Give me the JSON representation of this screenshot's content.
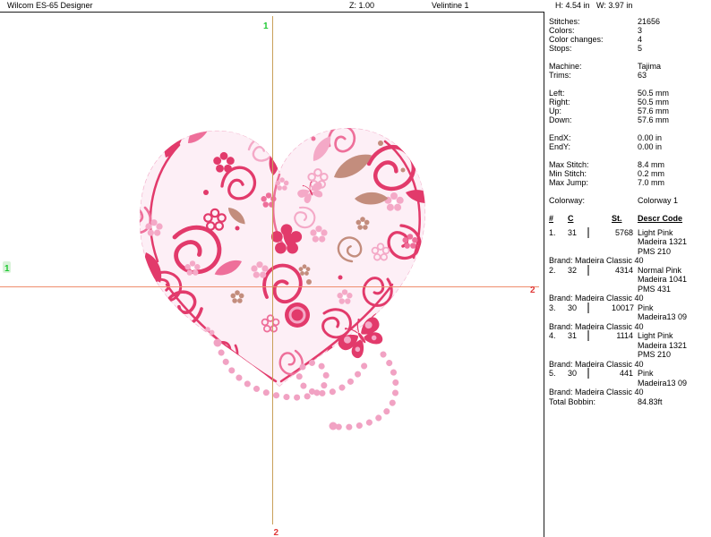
{
  "title_bar": {
    "app_name": "Wilcom ES-65 Designer",
    "zoom_level": "Z: 1.00",
    "design_name": "Velintine 1",
    "size_info": "H: 4.54 in   W: 3.97 in"
  },
  "canvas": {
    "start_marker_label": "1",
    "end_marker_label": "2",
    "start_marker_color": "#1ec832",
    "end_marker_color": "#e03838",
    "h_guide_color": "#ef8e6e",
    "v_guide_color": "#c9a05a"
  },
  "design": {
    "palette": {
      "deep_pink": "#e23a6b",
      "medium_pink": "#ee6f9a",
      "light_pink": "#f4a9c7",
      "mauve": "#c38d7d",
      "bead_pink": "#f1a2c3"
    }
  },
  "panel": {
    "stats": [
      {
        "label": "Stitches:",
        "value": "21656"
      },
      {
        "label": "Colors:",
        "value": "3"
      },
      {
        "label": "Color changes:",
        "value": "4"
      },
      {
        "label": "Stops:",
        "value": "5"
      }
    ],
    "machine": [
      {
        "label": "Machine:",
        "value": "Tajima"
      },
      {
        "label": "Trims:",
        "value": "63"
      }
    ],
    "margins": [
      {
        "label": "Left:",
        "value": "50.5 mm"
      },
      {
        "label": "Right:",
        "value": "50.5 mm"
      },
      {
        "label": "Up:",
        "value": "57.6 mm"
      },
      {
        "label": "Down:",
        "value": "57.6 mm"
      }
    ],
    "end_point": [
      {
        "label": "EndX:",
        "value": "0.00 in"
      },
      {
        "label": "EndY:",
        "value": "0.00 in"
      }
    ],
    "stitch_limits": [
      {
        "label": "Max Stitch:",
        "value": "8.4 mm"
      },
      {
        "label": "Min Stitch:",
        "value": "0.2 mm"
      },
      {
        "label": "Max Jump:",
        "value": "7.0 mm"
      }
    ],
    "colorway": {
      "label": "Colorway:",
      "value": "Colorway 1"
    },
    "table": {
      "headers": {
        "num": "#",
        "c": "C",
        "st": "St.",
        "descr": "Descr  Code"
      },
      "rows": [
        {
          "num": "1.",
          "c": "31",
          "swatch": "#d393bd",
          "st": "5768",
          "descr": [
            "Light Pink",
            "Madeira 1321",
            "PMS 210"
          ],
          "brand": "Brand: Madeira Classic 40"
        },
        {
          "num": "2.",
          "c": "32",
          "swatch": "#bd6379",
          "st": "4314",
          "descr": [
            "Normal Pink",
            "Madeira 1041",
            "PMS 431"
          ],
          "brand": "Brand: Madeira Classic 40"
        },
        {
          "num": "3.",
          "c": "30",
          "swatch": "#d34a73",
          "st": "10017",
          "descr": [
            "Pink",
            "Madeira13 09"
          ],
          "brand": "Brand: Madeira Classic 40"
        },
        {
          "num": "4.",
          "c": "31",
          "swatch": "#d393bd",
          "st": "1114",
          "descr": [
            "Light Pink",
            "Madeira 1321",
            "PMS 210"
          ],
          "brand": "Brand: Madeira Classic 40"
        },
        {
          "num": "5.",
          "c": "30",
          "swatch": "#d34a73",
          "st": "441",
          "descr": [
            "Pink",
            "Madeira13 09"
          ],
          "brand": "Brand: Madeira Classic 40"
        }
      ]
    },
    "total": {
      "label": "Total Bobbin:",
      "value": "84.83ft"
    }
  }
}
